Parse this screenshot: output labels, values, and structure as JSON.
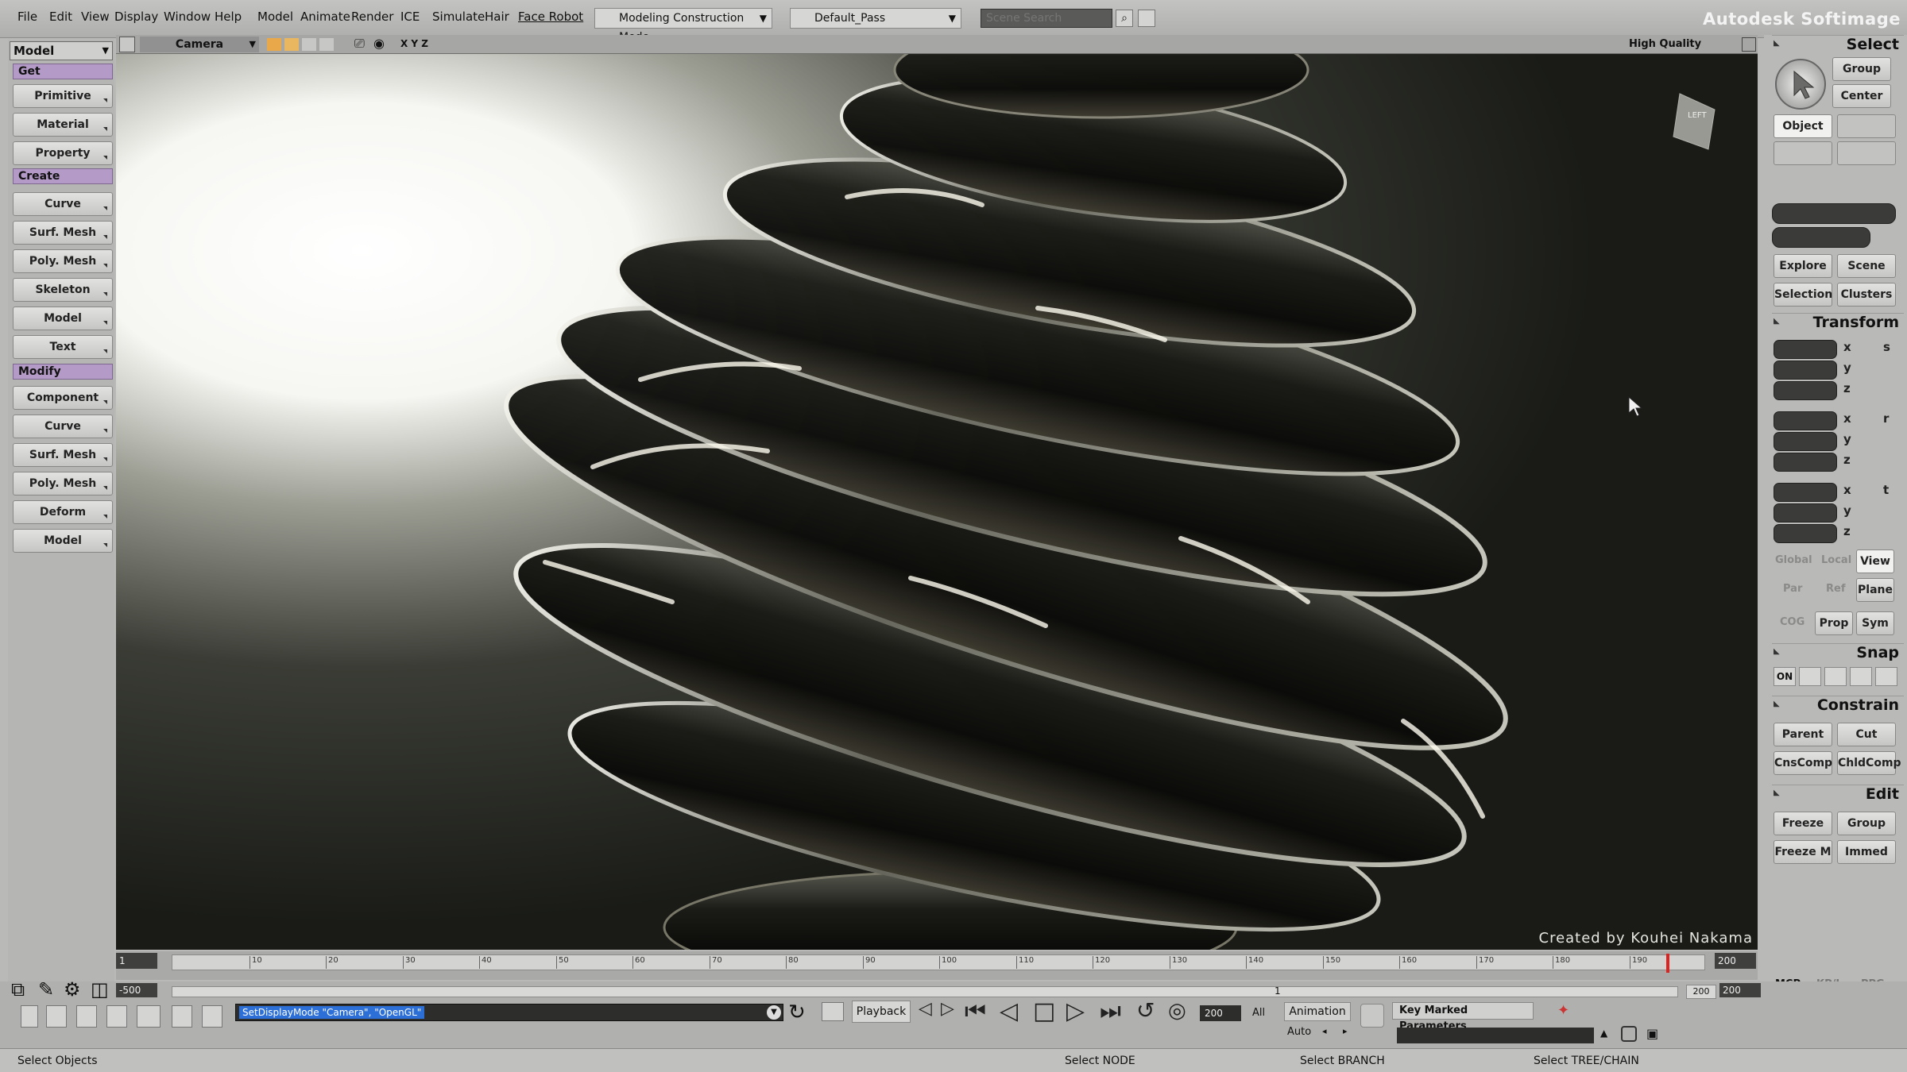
{
  "menubar": {
    "items": [
      "File",
      "Edit",
      "View",
      "Display",
      "Window",
      "Help",
      "Model",
      "Animate",
      "Render",
      "ICE",
      "Simulate",
      "Hair",
      "Face Robot"
    ],
    "mode_combo": "Modeling Construction Mode",
    "pass_combo": "Default_Pass",
    "search_placeholder": "Scene Search",
    "brand": "Autodesk Softimage"
  },
  "left_panel": {
    "module": "Model",
    "sections": [
      {
        "title": "Get",
        "items": [
          "Primitive",
          "Material",
          "Property"
        ]
      },
      {
        "title": "Create",
        "items": [
          "Curve",
          "Surf. Mesh",
          "Poly. Mesh",
          "Skeleton",
          "Model",
          "Text"
        ]
      },
      {
        "title": "Modify",
        "items": [
          "Component",
          "Curve",
          "Surf. Mesh",
          "Poly. Mesh",
          "Deform",
          "Model"
        ]
      }
    ]
  },
  "viewport": {
    "camera_label": "Camera",
    "axes_label": "X Y Z",
    "quality_label": "High Quality",
    "cube_label": "LEFT",
    "credit": "Created by Kouhei Nakama"
  },
  "right_panel": {
    "select": {
      "title": "Select",
      "group": "Group",
      "center": "Center",
      "object": "Object",
      "explore": "Explore",
      "scene": "Scene",
      "selection": "Selection",
      "clusters": "Clusters"
    },
    "transform": {
      "title": "Transform",
      "axes": [
        "x",
        "y",
        "z"
      ],
      "row_icons": [
        "s",
        "r",
        "t"
      ],
      "global": "Global",
      "local": "Local",
      "view": "View",
      "par": "Par",
      "ref": "Ref",
      "plane": "Plane",
      "cog": "COG",
      "prop": "Prop",
      "sym": "Sym"
    },
    "snap": {
      "title": "Snap",
      "on": "ON"
    },
    "constrain": {
      "title": "Constrain",
      "parent": "Parent",
      "cut": "Cut",
      "cnscomp": "CnsComp",
      "childcomp": "ChldComp"
    },
    "edit": {
      "title": "Edit",
      "freeze": "Freeze",
      "group": "Group",
      "freeze_m": "Freeze M",
      "immed": "Immed"
    },
    "footer": [
      "MCP",
      "KP/L",
      "PPG"
    ]
  },
  "timeline": {
    "start": "1",
    "start_field": "1",
    "start_field2": "-500",
    "ticks": [
      "10",
      "20",
      "30",
      "40",
      "50",
      "60",
      "70",
      "80",
      "90",
      "100",
      "110",
      "120",
      "130",
      "140",
      "150",
      "160",
      "170",
      "180",
      "190"
    ],
    "end_field": "200",
    "end_field2": "200",
    "range_end": "200",
    "range_start": "1"
  },
  "bottom": {
    "script_line": "SetDisplayMode \"Camera\", \"OpenGL\"",
    "playback": "Playback",
    "frame": "200",
    "all": "All",
    "animation": "Animation",
    "auto": "Auto",
    "key_params": "Key Marked Parameters"
  },
  "status": {
    "left": "Select Objects",
    "node": "Select NODE",
    "branch": "Select BRANCH",
    "tree": "Select TREE/CHAIN"
  }
}
